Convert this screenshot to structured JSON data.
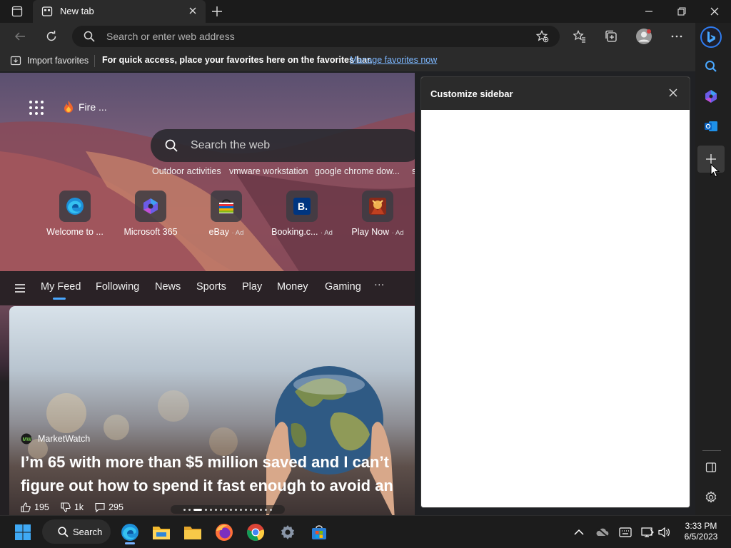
{
  "browser": {
    "tab_title": "New tab",
    "address_placeholder": "Search or enter web address",
    "favorites_bar": {
      "import_label": "Import favorites",
      "message": "For quick access, place your favorites here on the favorites bar.",
      "manage_link": "Manage favorites now"
    }
  },
  "ntp": {
    "weather_label": "Fire ...",
    "search_placeholder": "Search the web",
    "trending": [
      "Outdoor activities",
      "vmware workstation",
      "google chrome dow...",
      "s"
    ],
    "sites": [
      {
        "label": "Welcome to ...",
        "ad": "",
        "icon": "edge-icon"
      },
      {
        "label": "Microsoft 365",
        "ad": "",
        "icon": "microsoft-365-icon"
      },
      {
        "label": "eBay",
        "ad": "· Ad",
        "icon": "ebay-icon"
      },
      {
        "label": "Booking.c...",
        "ad": "· Ad",
        "icon": "booking-icon"
      },
      {
        "label": "Play Now",
        "ad": "· Ad",
        "icon": "game-icon"
      }
    ],
    "feed_tabs": [
      "My Feed",
      "Following",
      "News",
      "Sports",
      "Play",
      "Money",
      "Gaming",
      "···"
    ],
    "card": {
      "source": "MarketWatch",
      "headline": "I’m 65 with more than $5 million saved and I can’t\nfigure out how to spend it fast enough to avoid an",
      "likes": "195",
      "dislikes": "1k",
      "comments": "295"
    }
  },
  "panel": {
    "title": "Customize sidebar"
  },
  "taskbar": {
    "search_label": "Search",
    "time": "3:33 PM",
    "date": "6/5/2023"
  },
  "colors": {
    "accent_blue": "#4aa8ff",
    "link": "#7cb7ff"
  }
}
